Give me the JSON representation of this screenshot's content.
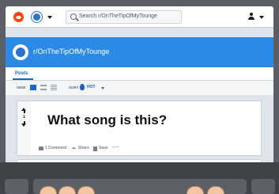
{
  "header": {
    "search_placeholder": "Search r/OnTheTipOfMyTounge"
  },
  "subreddit": {
    "title": "r/OnTheTipOfMyTounge"
  },
  "tabs": [
    {
      "label": "Posts",
      "active": true
    }
  ],
  "toolbar": {
    "view_label": "VIEW",
    "sort_label": "SORT",
    "sort_value": "HOT"
  },
  "post": {
    "score": "1",
    "title": "What song is this?",
    "actions": {
      "comments": "1 Comment",
      "share": "Share",
      "save": "Save",
      "more": "···"
    }
  },
  "colors": {
    "banner": "#2b8ae6",
    "accent": "#1a63c3",
    "reddit_orange": "#ff4500"
  },
  "icons": [
    "reddit-logo-icon",
    "community-icon",
    "search-icon",
    "user-icon",
    "flame-icon",
    "upvote-icon",
    "downvote-icon",
    "comment-icon",
    "share-icon",
    "save-icon",
    "more-icon"
  ]
}
